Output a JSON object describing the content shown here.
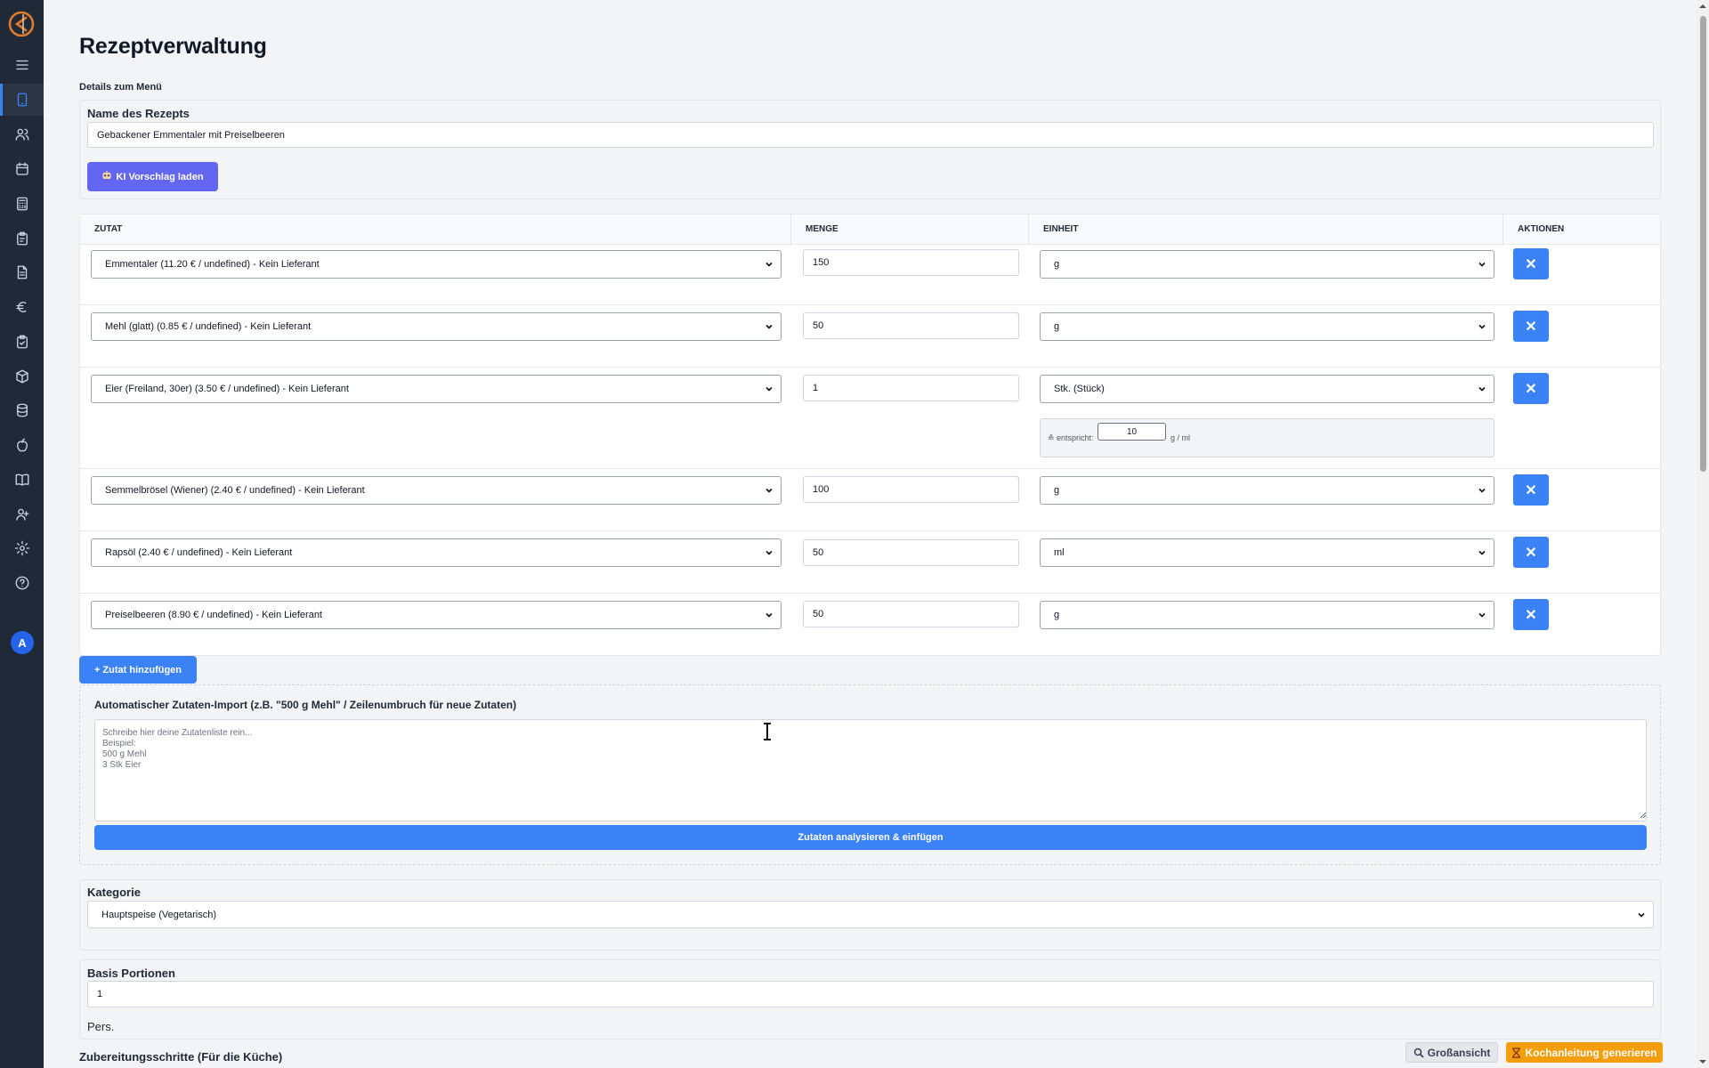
{
  "sidebar": {
    "items": [
      {
        "icon": "menu-icon"
      },
      {
        "icon": "tablet-icon",
        "active": true
      },
      {
        "icon": "users-icon"
      },
      {
        "icon": "calendar-icon"
      },
      {
        "icon": "calculator-icon"
      },
      {
        "icon": "clipboard-icon"
      },
      {
        "icon": "document-icon"
      },
      {
        "icon": "euro-icon"
      },
      {
        "icon": "clipboard-check-icon"
      },
      {
        "icon": "package-icon"
      },
      {
        "icon": "database-icon"
      },
      {
        "icon": "apple-icon"
      },
      {
        "icon": "book-icon"
      },
      {
        "icon": "user-plus-icon"
      },
      {
        "icon": "settings-icon"
      },
      {
        "icon": "help-icon"
      }
    ],
    "avatar": "A"
  },
  "page": {
    "title": "Rezeptverwaltung",
    "section_label": "Details zum Menü"
  },
  "recipe": {
    "name_label": "Name des Rezepts",
    "name_value": "Gebackener Emmentaler mit Preiselbeeren",
    "ai_button": "KI Vorschlag laden"
  },
  "table": {
    "headers": {
      "ingredient": "ZUTAT",
      "quantity": "MENGE",
      "unit": "EINHEIT",
      "actions": "AKTIONEN"
    },
    "rows": [
      {
        "ingredient": "Emmentaler (11.20 € / undefined) - Kein Lieferant",
        "quantity": "150",
        "unit": "g"
      },
      {
        "ingredient": "Mehl (glatt) (0.85 € / undefined) - Kein Lieferant",
        "quantity": "50",
        "unit": "g"
      },
      {
        "ingredient": "Eier (Freiland, 30er) (3.50 € / undefined) - Kein Lieferant",
        "quantity": "1",
        "unit": "Stk. (Stück)"
      },
      {
        "ingredient": "Semmelbrösel (Wiener) (2.40 € / undefined) - Kein Lieferant",
        "quantity": "100",
        "unit": "g"
      },
      {
        "ingredient": "Rapsöl (2.40 € / undefined) - Kein Lieferant",
        "quantity": "50",
        "unit": "ml"
      },
      {
        "ingredient": "Preiselbeeren (8.90 € / undefined) - Kein Lieferant",
        "quantity": "50",
        "unit": "g"
      }
    ],
    "delete_symbol": "✕",
    "equivalent": {
      "label": "≙ entspricht:",
      "value": "10",
      "unit": "g / ml"
    }
  },
  "add_ingredient_button": "+ Zutat hinzufügen",
  "import": {
    "title": "Automatischer Zutaten-Import (z.B. \"500 g Mehl\" / Zeilenumbruch für neue Zutaten)",
    "placeholder": "Schreibe hier deine Zutatenliste rein...\nBeispiel:\n500 g Mehl\n3 Stk Eier",
    "button": "Zutaten analysieren & einfügen"
  },
  "category": {
    "label": "Kategorie",
    "value": "Hauptspeise (Vegetarisch)"
  },
  "portions": {
    "label": "Basis Portionen",
    "value": "1",
    "unit": "Pers."
  },
  "steps": {
    "label": "Zubereitungsschritte (Für die Küche)"
  },
  "footer": {
    "zoom_button": "Großansicht",
    "generate_button": "Kochanleitung generieren"
  },
  "colors": {
    "sidebar": "#1f2937",
    "primary": "#3b82f6",
    "purple": "#6366f1",
    "orange": "#f59e0b"
  }
}
